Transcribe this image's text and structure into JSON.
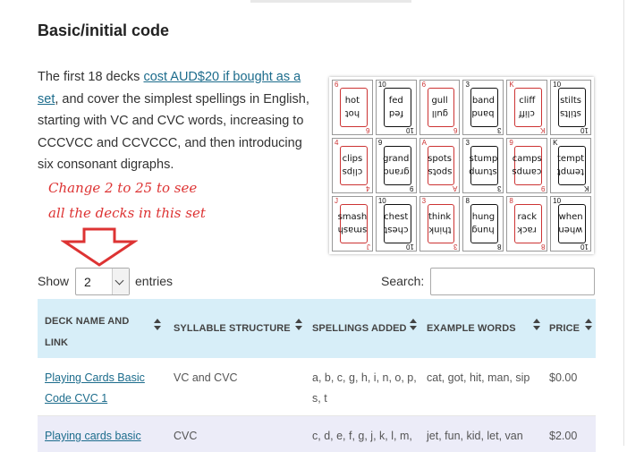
{
  "heading": "Basic/initial code",
  "intro": {
    "text_before": "The first 18 decks ",
    "link": "cost AUD$20 if bought as a set",
    "text_after": ", and cover the simplest spellings in English, starting with VC and CVC words, increasing to CCCVCC and CCVCCC, and then introducing six consonant digraphs."
  },
  "annotation": {
    "line1": "Change 2 to 25 to see",
    "line2": "all the decks in this set",
    "color": "#dd3333"
  },
  "cards": [
    {
      "rank": "6",
      "word": "hot",
      "color": "red"
    },
    {
      "rank": "10",
      "word": "fed",
      "color": "black"
    },
    {
      "rank": "6",
      "word": "gull",
      "color": "red"
    },
    {
      "rank": "3",
      "word": "band",
      "color": "black"
    },
    {
      "rank": "K",
      "word": "cliff",
      "color": "red"
    },
    {
      "rank": "10",
      "word": "stilts",
      "color": "black"
    },
    {
      "rank": "4",
      "word": "clips",
      "color": "red"
    },
    {
      "rank": "9",
      "word": "grand",
      "color": "black"
    },
    {
      "rank": "A",
      "word": "spots",
      "color": "red"
    },
    {
      "rank": "3",
      "word": "stump",
      "color": "black"
    },
    {
      "rank": "9",
      "word": "camps",
      "color": "red"
    },
    {
      "rank": "K",
      "word": "tempt",
      "color": "black"
    },
    {
      "rank": "J",
      "word": "smash",
      "color": "red"
    },
    {
      "rank": "10",
      "word": "chest",
      "color": "black"
    },
    {
      "rank": "3",
      "word": "think",
      "color": "red"
    },
    {
      "rank": "8",
      "word": "hung",
      "color": "black"
    },
    {
      "rank": "8",
      "word": "rack",
      "color": "red"
    },
    {
      "rank": "10",
      "word": "when",
      "color": "black"
    }
  ],
  "controls": {
    "show_label": "Show",
    "entries_value": "2",
    "entries_label": "entries",
    "search_label": "Search:",
    "search_value": ""
  },
  "table": {
    "header_bg": "#d7eef8",
    "columns": [
      "DECK NAME AND LINK",
      "SYLLABLE STRUCTURE",
      "SPELLINGS ADDED",
      "EXAMPLE WORDS",
      "PRICE"
    ],
    "col1_lines": [
      "DECK NAME AND",
      "LINK"
    ],
    "rows": [
      {
        "name_lines": [
          "Playing Cards Basic",
          "Code CVC 1"
        ],
        "structure": "VC and CVC",
        "spellings_lines": [
          "a, b, c, g, h, i, n, o, p,",
          "s, t"
        ],
        "examples": "cat, got, hit, man, sip",
        "price": "$0.00"
      },
      {
        "name_lines": [
          "Playing cards basic",
          ""
        ],
        "structure": "CVC",
        "spellings_lines": [
          "c, d, e, f, g, j, k, l, m,",
          ""
        ],
        "examples": "jet, fun, kid, let, van",
        "price": "$2.00"
      }
    ]
  }
}
